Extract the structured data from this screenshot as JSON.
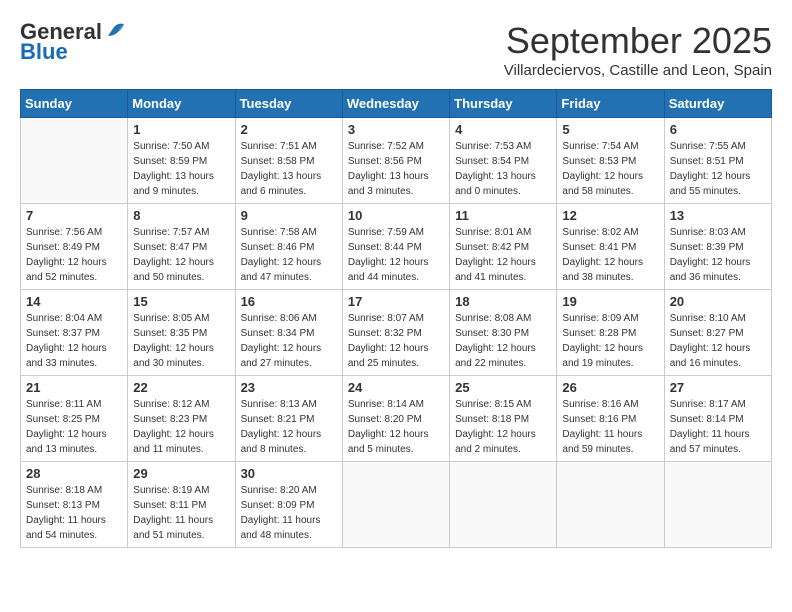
{
  "header": {
    "logo_general": "General",
    "logo_blue": "Blue",
    "month_title": "September 2025",
    "subtitle": "Villardeciervos, Castille and Leon, Spain"
  },
  "days_of_week": [
    "Sunday",
    "Monday",
    "Tuesday",
    "Wednesday",
    "Thursday",
    "Friday",
    "Saturday"
  ],
  "weeks": [
    [
      {
        "day": "",
        "info": ""
      },
      {
        "day": "1",
        "info": "Sunrise: 7:50 AM\nSunset: 8:59 PM\nDaylight: 13 hours\nand 9 minutes."
      },
      {
        "day": "2",
        "info": "Sunrise: 7:51 AM\nSunset: 8:58 PM\nDaylight: 13 hours\nand 6 minutes."
      },
      {
        "day": "3",
        "info": "Sunrise: 7:52 AM\nSunset: 8:56 PM\nDaylight: 13 hours\nand 3 minutes."
      },
      {
        "day": "4",
        "info": "Sunrise: 7:53 AM\nSunset: 8:54 PM\nDaylight: 13 hours\nand 0 minutes."
      },
      {
        "day": "5",
        "info": "Sunrise: 7:54 AM\nSunset: 8:53 PM\nDaylight: 12 hours\nand 58 minutes."
      },
      {
        "day": "6",
        "info": "Sunrise: 7:55 AM\nSunset: 8:51 PM\nDaylight: 12 hours\nand 55 minutes."
      }
    ],
    [
      {
        "day": "7",
        "info": "Sunrise: 7:56 AM\nSunset: 8:49 PM\nDaylight: 12 hours\nand 52 minutes."
      },
      {
        "day": "8",
        "info": "Sunrise: 7:57 AM\nSunset: 8:47 PM\nDaylight: 12 hours\nand 50 minutes."
      },
      {
        "day": "9",
        "info": "Sunrise: 7:58 AM\nSunset: 8:46 PM\nDaylight: 12 hours\nand 47 minutes."
      },
      {
        "day": "10",
        "info": "Sunrise: 7:59 AM\nSunset: 8:44 PM\nDaylight: 12 hours\nand 44 minutes."
      },
      {
        "day": "11",
        "info": "Sunrise: 8:01 AM\nSunset: 8:42 PM\nDaylight: 12 hours\nand 41 minutes."
      },
      {
        "day": "12",
        "info": "Sunrise: 8:02 AM\nSunset: 8:41 PM\nDaylight: 12 hours\nand 38 minutes."
      },
      {
        "day": "13",
        "info": "Sunrise: 8:03 AM\nSunset: 8:39 PM\nDaylight: 12 hours\nand 36 minutes."
      }
    ],
    [
      {
        "day": "14",
        "info": "Sunrise: 8:04 AM\nSunset: 8:37 PM\nDaylight: 12 hours\nand 33 minutes."
      },
      {
        "day": "15",
        "info": "Sunrise: 8:05 AM\nSunset: 8:35 PM\nDaylight: 12 hours\nand 30 minutes."
      },
      {
        "day": "16",
        "info": "Sunrise: 8:06 AM\nSunset: 8:34 PM\nDaylight: 12 hours\nand 27 minutes."
      },
      {
        "day": "17",
        "info": "Sunrise: 8:07 AM\nSunset: 8:32 PM\nDaylight: 12 hours\nand 25 minutes."
      },
      {
        "day": "18",
        "info": "Sunrise: 8:08 AM\nSunset: 8:30 PM\nDaylight: 12 hours\nand 22 minutes."
      },
      {
        "day": "19",
        "info": "Sunrise: 8:09 AM\nSunset: 8:28 PM\nDaylight: 12 hours\nand 19 minutes."
      },
      {
        "day": "20",
        "info": "Sunrise: 8:10 AM\nSunset: 8:27 PM\nDaylight: 12 hours\nand 16 minutes."
      }
    ],
    [
      {
        "day": "21",
        "info": "Sunrise: 8:11 AM\nSunset: 8:25 PM\nDaylight: 12 hours\nand 13 minutes."
      },
      {
        "day": "22",
        "info": "Sunrise: 8:12 AM\nSunset: 8:23 PM\nDaylight: 12 hours\nand 11 minutes."
      },
      {
        "day": "23",
        "info": "Sunrise: 8:13 AM\nSunset: 8:21 PM\nDaylight: 12 hours\nand 8 minutes."
      },
      {
        "day": "24",
        "info": "Sunrise: 8:14 AM\nSunset: 8:20 PM\nDaylight: 12 hours\nand 5 minutes."
      },
      {
        "day": "25",
        "info": "Sunrise: 8:15 AM\nSunset: 8:18 PM\nDaylight: 12 hours\nand 2 minutes."
      },
      {
        "day": "26",
        "info": "Sunrise: 8:16 AM\nSunset: 8:16 PM\nDaylight: 11 hours\nand 59 minutes."
      },
      {
        "day": "27",
        "info": "Sunrise: 8:17 AM\nSunset: 8:14 PM\nDaylight: 11 hours\nand 57 minutes."
      }
    ],
    [
      {
        "day": "28",
        "info": "Sunrise: 8:18 AM\nSunset: 8:13 PM\nDaylight: 11 hours\nand 54 minutes."
      },
      {
        "day": "29",
        "info": "Sunrise: 8:19 AM\nSunset: 8:11 PM\nDaylight: 11 hours\nand 51 minutes."
      },
      {
        "day": "30",
        "info": "Sunrise: 8:20 AM\nSunset: 8:09 PM\nDaylight: 11 hours\nand 48 minutes."
      },
      {
        "day": "",
        "info": ""
      },
      {
        "day": "",
        "info": ""
      },
      {
        "day": "",
        "info": ""
      },
      {
        "day": "",
        "info": ""
      }
    ]
  ]
}
